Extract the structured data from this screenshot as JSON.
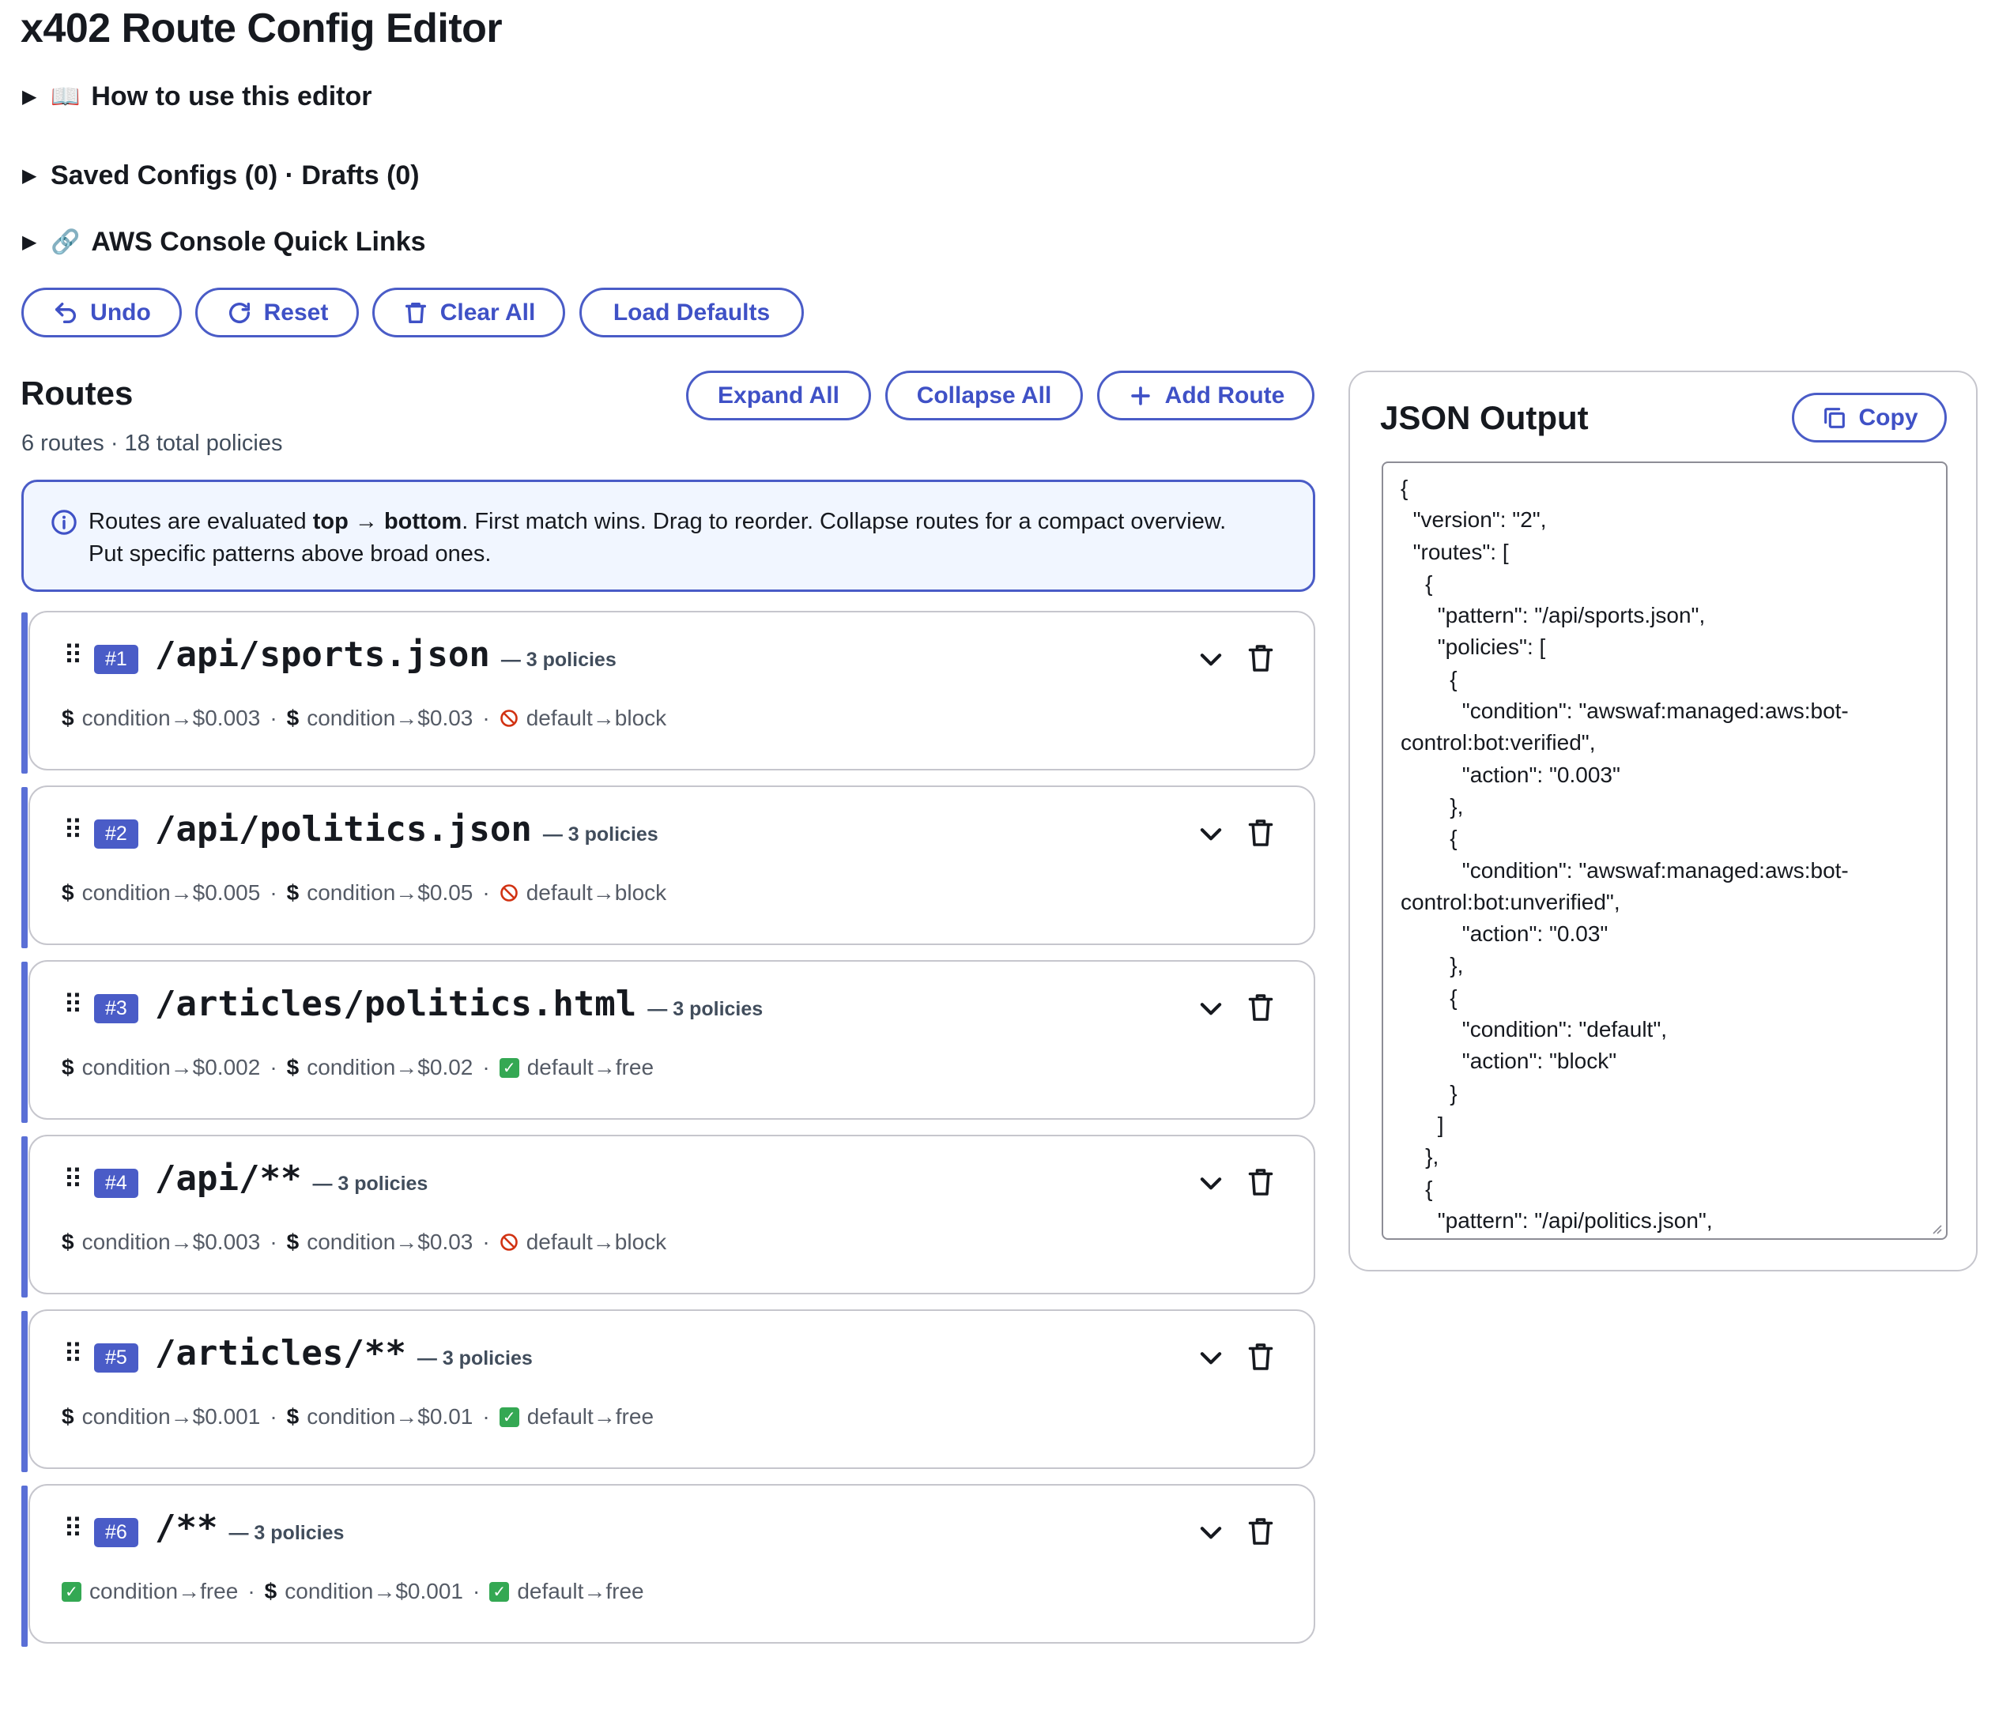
{
  "app": {
    "title": "x402 Route Config Editor"
  },
  "sections": {
    "how_to": {
      "emoji": "📖",
      "label": "How to use this editor"
    },
    "saved": {
      "label": "Saved Configs (0) · Drafts (0)"
    },
    "aws": {
      "emoji": "🔗",
      "label": "AWS Console Quick Links"
    }
  },
  "toolbar": {
    "undo": "Undo",
    "reset": "Reset",
    "clear_all": "Clear All",
    "load_defaults": "Load Defaults"
  },
  "routes": {
    "heading": "Routes",
    "subtitle": "6 routes · 18 total policies",
    "expand_all": "Expand All",
    "collapse_all": "Collapse All",
    "add_route": "Add Route",
    "info": {
      "prefix": "Routes are evaluated ",
      "bold1": "top → bottom",
      "middle": ". First match wins. Drag to reorder. Collapse routes for a compact overview.",
      "line2": "Put specific patterns above broad ones."
    },
    "items": [
      {
        "badge": "#1",
        "pattern": "/api/sports.json",
        "count": "— 3 policies",
        "summary": [
          {
            "icon": "dollar-icon",
            "text": "condition→$0.003"
          },
          {
            "icon": "dollar-icon",
            "text": "condition→$0.03"
          },
          {
            "icon": "block-icon",
            "text": "default→block"
          }
        ]
      },
      {
        "badge": "#2",
        "pattern": "/api/politics.json",
        "count": "— 3 policies",
        "summary": [
          {
            "icon": "dollar-icon",
            "text": "condition→$0.005"
          },
          {
            "icon": "dollar-icon",
            "text": "condition→$0.05"
          },
          {
            "icon": "block-icon",
            "text": "default→block"
          }
        ]
      },
      {
        "badge": "#3",
        "pattern": "/articles/politics.html",
        "count": "— 3 policies",
        "summary": [
          {
            "icon": "dollar-icon",
            "text": "condition→$0.002"
          },
          {
            "icon": "dollar-icon",
            "text": "condition→$0.02"
          },
          {
            "icon": "check-icon",
            "text": "default→free"
          }
        ]
      },
      {
        "badge": "#4",
        "pattern": "/api/**",
        "count": "— 3 policies",
        "summary": [
          {
            "icon": "dollar-icon",
            "text": "condition→$0.003"
          },
          {
            "icon": "dollar-icon",
            "text": "condition→$0.03"
          },
          {
            "icon": "block-icon",
            "text": "default→block"
          }
        ]
      },
      {
        "badge": "#5",
        "pattern": "/articles/**",
        "count": "— 3 policies",
        "summary": [
          {
            "icon": "dollar-icon",
            "text": "condition→$0.001"
          },
          {
            "icon": "dollar-icon",
            "text": "condition→$0.01"
          },
          {
            "icon": "check-icon",
            "text": "default→free"
          }
        ]
      },
      {
        "badge": "#6",
        "pattern": "/**",
        "count": "— 3 policies",
        "summary": [
          {
            "icon": "check-icon",
            "text": "condition→free"
          },
          {
            "icon": "dollar-icon",
            "text": "condition→$0.001"
          },
          {
            "icon": "check-icon",
            "text": "default→free"
          }
        ]
      }
    ]
  },
  "json_output": {
    "heading": "JSON Output",
    "copy": "Copy",
    "text": "{\n  \"version\": \"2\",\n  \"routes\": [\n    {\n      \"pattern\": \"/api/sports.json\",\n      \"policies\": [\n        {\n          \"condition\": \"awswaf:managed:aws:bot-control:bot:verified\",\n          \"action\": \"0.003\"\n        },\n        {\n          \"condition\": \"awswaf:managed:aws:bot-control:bot:unverified\",\n          \"action\": \"0.03\"\n        },\n        {\n          \"condition\": \"default\",\n          \"action\": \"block\"\n        }\n      ]\n    },\n    {\n      \"pattern\": \"/api/politics.json\","
  },
  "colors": {
    "accent": "#4a5cc7",
    "route_bar": "#5a6fd6",
    "free_green": "#34a853",
    "block_red": "#d13212"
  }
}
